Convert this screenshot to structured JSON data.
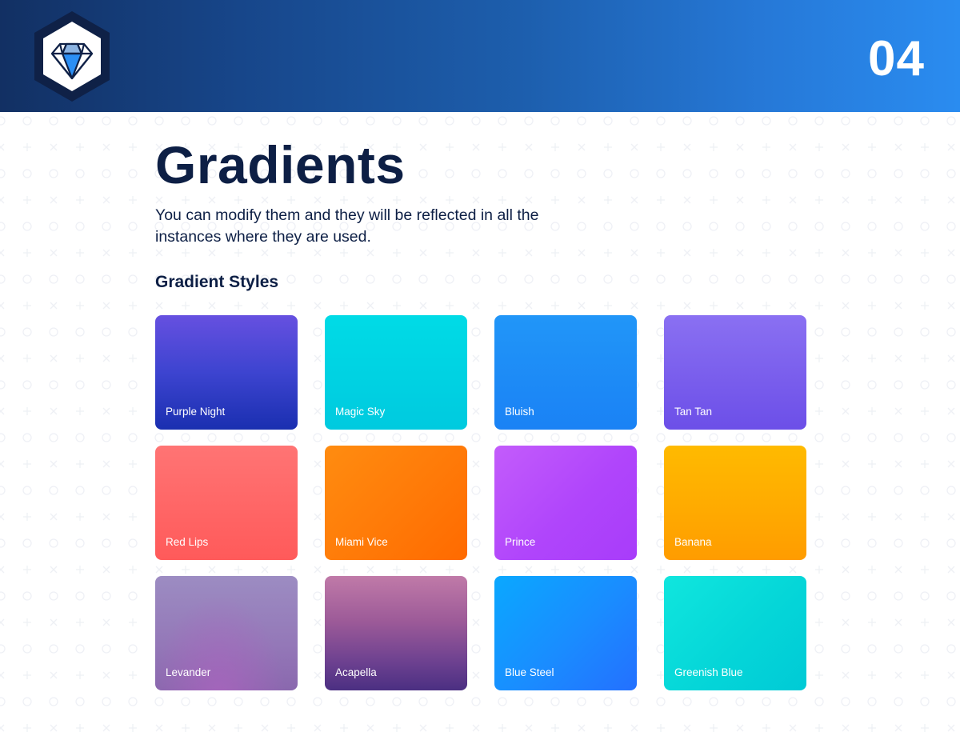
{
  "header": {
    "logo_icon": "diamond-icon",
    "page_number": "04",
    "colors": {
      "gradient_start": "#123063",
      "gradient_end": "#2a8cf0"
    }
  },
  "main": {
    "title": "Gradients",
    "description": "You can modify them and they will be reflected in all the instances where they are used.",
    "section_title": "Gradient Styles",
    "text_color": "#0d1f45"
  },
  "gradients": [
    {
      "name": "Purple Night",
      "colors": [
        "#6650e0",
        "#1a2fb0"
      ]
    },
    {
      "name": "Magic Sky",
      "colors": [
        "#00dbe6",
        "#00cadf"
      ]
    },
    {
      "name": "Bluish",
      "colors": [
        "#2196f8",
        "#1a82f5"
      ]
    },
    {
      "name": "Tan Tan",
      "colors": [
        "#8a70f2",
        "#6c4fe8"
      ]
    },
    {
      "name": "Red Lips",
      "colors": [
        "#ff7474",
        "#ff5a5a"
      ]
    },
    {
      "name": "Miami Vice",
      "colors": [
        "#ff8c10",
        "#ff6a00"
      ]
    },
    {
      "name": "Prince",
      "colors": [
        "#c35cfb",
        "#a83cfa"
      ]
    },
    {
      "name": "Banana",
      "colors": [
        "#ffba00",
        "#ff9c00"
      ]
    },
    {
      "name": "Levander",
      "colors": [
        "#9c8cc2",
        "#aa64be"
      ]
    },
    {
      "name": "Acapella",
      "colors": [
        "#c07aa8",
        "#4b2f82"
      ]
    },
    {
      "name": "Blue Steel",
      "colors": [
        "#0aa8ff",
        "#2470ff"
      ]
    },
    {
      "name": "Greenish Blue",
      "colors": [
        "#10e6de",
        "#00cad6"
      ]
    }
  ]
}
